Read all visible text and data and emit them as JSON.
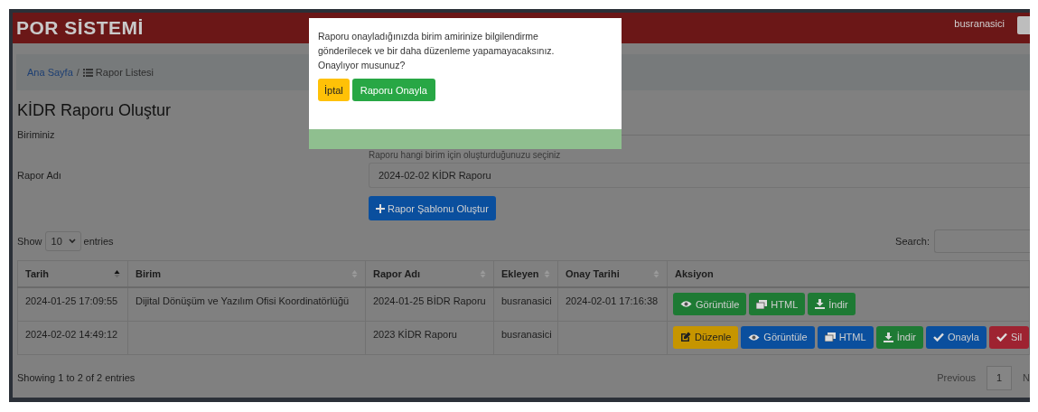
{
  "header": {
    "title": "POR SİSTEMİ",
    "user": "busranasici"
  },
  "breadcrumb": {
    "separator": "/",
    "items": [
      {
        "label": "Ana Sayfa",
        "kind": "link"
      },
      {
        "label": "Rapor Listesi",
        "kind": "current"
      }
    ]
  },
  "page_title": "KİDR Raporu Oluştur",
  "form": {
    "unit_label": "Biriminiz",
    "unit_hint": "Raporu hangi birim için oluşturduğunuzu seçiniz",
    "name_label": "Rapor Adı",
    "name_value": "2024-02-02 KİDR Raporu",
    "create_button": "Rapor Şablonu Oluştur"
  },
  "table_controls": {
    "show": "Show",
    "length": "10",
    "entries": "entries",
    "search_label": "Search:"
  },
  "table": {
    "columns": [
      {
        "label": "Tarih",
        "sortable": true,
        "sorted": true
      },
      {
        "label": "Birim",
        "sortable": true,
        "sorted": false
      },
      {
        "label": "Rapor Adı",
        "sortable": true,
        "sorted": false
      },
      {
        "label": "Ekleyen",
        "sortable": true,
        "sorted": false
      },
      {
        "label": "Onay Tarihi",
        "sortable": true,
        "sorted": false
      },
      {
        "label": "Aksiyon",
        "sortable": false
      }
    ],
    "rows": [
      {
        "date": "2024-01-25 17:09:55",
        "unit": "Dijital Dönüşüm ve Yazılım Ofisi Koordinatörlüğü",
        "name": "2024-01-25 BİDR Raporu",
        "added_by": "busranasici",
        "approved": "2024-02-01 17:16:38",
        "actions": [
          {
            "kind": "view",
            "label": "Görüntüle",
            "color": "#1e7a34"
          },
          {
            "kind": "html",
            "label": "HTML",
            "color": "#1e7a34"
          },
          {
            "kind": "download",
            "label": "İndir",
            "color": "#1e7a34"
          }
        ]
      },
      {
        "date": "2024-02-02 14:49:12",
        "name": "2023 KİDR Raporu",
        "added_by": "busranasici",
        "actions": [
          {
            "kind": "edit",
            "label": "Düzenle",
            "color": "#c69500"
          },
          {
            "kind": "view",
            "label": "Görüntüle",
            "color": "#0a4f9e"
          },
          {
            "kind": "html",
            "label": "HTML",
            "color": "#0a4f9e"
          },
          {
            "kind": "download",
            "label": "İndir",
            "color": "#1e7a34"
          },
          {
            "kind": "approve",
            "label": "Onayla",
            "color": "#0a4f9e"
          },
          {
            "kind": "delete",
            "label": "Sil",
            "color": "#9e2331"
          }
        ]
      }
    ]
  },
  "footer": {
    "info": "Showing 1 to 2 of 2 entries",
    "previous": "Previous",
    "page": "1",
    "next": "N"
  },
  "modal": {
    "message": "Raporu onayladığınızda birim amirinize bilgilendirme gönderilecek ve bir daha düzenleme yapamayacaksınız. Onaylıyor musunuz?",
    "cancel": "İptal",
    "confirm": "Raporu Onayla"
  }
}
